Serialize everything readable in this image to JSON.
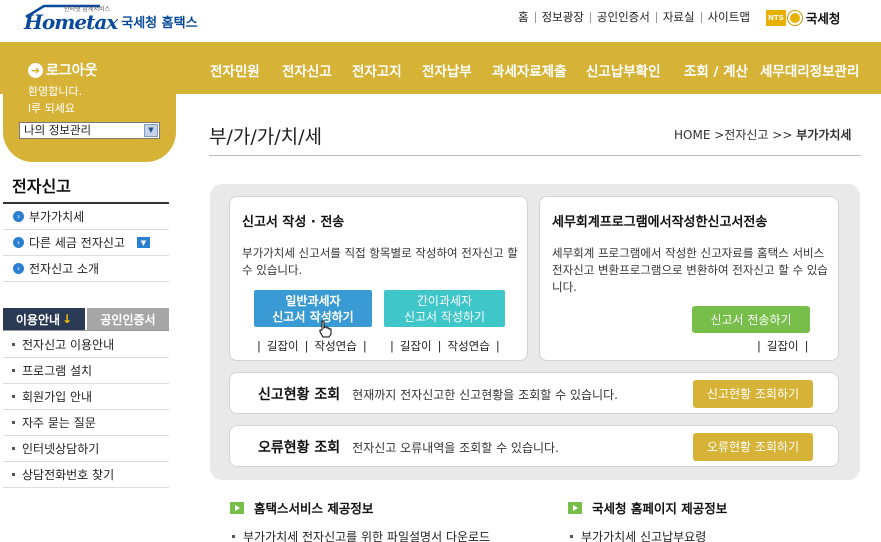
{
  "header": {
    "logo_small": "인터넷 납세서비스",
    "logo_word": "Hometax",
    "logo_sub": "국세청 홈택스",
    "top_links": [
      "홈",
      "정보광장",
      "공인인증서",
      "자료실",
      "사이트맵"
    ],
    "nts_badge": "NTS",
    "nts_name": "국세청"
  },
  "nav": {
    "items": [
      "전자민원",
      "전자신고",
      "전자고지",
      "전자납부",
      "과세자료제출",
      "신고납부확인",
      "조회 / 계산",
      "세무대리정보관리"
    ]
  },
  "login": {
    "logout_label": "로그아웃",
    "welcome_line1": "환영합니다.",
    "welcome_line2": "l루 되세요",
    "my_info_select": "나의 정보관리"
  },
  "sidebar": {
    "title": "전자신고",
    "items": [
      {
        "label": "부가가치세"
      },
      {
        "label": "다른 세금 전자신고"
      },
      {
        "label": "전자신고 소개"
      }
    ],
    "tab_guide": "이용안내",
    "tab_guide_arrow": "↓",
    "tab_cert": "공인인증서",
    "guide_items": [
      "전자신고 이용안내",
      "프로그램 설치",
      "회원가입 안내",
      "자주 묻는 질문",
      "인터넷상담하기",
      "상담전화번호 찾기"
    ]
  },
  "main": {
    "page_title": "부/가/가/치/세",
    "breadcrumb": {
      "home": "HOME",
      "sep1": ">",
      "level1": "전자신고",
      "sep2": ">>",
      "current": "부가가치세"
    },
    "card_write": {
      "title": "신고서 작성 · 전송",
      "desc": "부가가치세 신고서를 직접 항목별로 작성하여 전자신고 할 수 있습니다.",
      "btn_general_line1": "일반과세자",
      "btn_general_line2": "신고서 작성하기",
      "btn_simple_line1": "간이과세자",
      "btn_simple_line2": "신고서 작성하기",
      "guide_link": "길잡이",
      "practice_link": "작성연습"
    },
    "card_program": {
      "title": "세무회계프로그램에서작성한신고서전송",
      "desc": "세무회계 프로그램에서 작성한 신고자료를 홈택스 서비스 전자신고 변환프로그램으로 변환하여 전자신고 할 수 있습니다.",
      "btn_send": "신고서 전송하기",
      "guide_link": "길잡이"
    },
    "status": {
      "title": "신고현황 조회",
      "desc": "현재까지 전자신고한 신고현황을 조회할 수 있습니다.",
      "button": "신고현황 조회하기"
    },
    "errors": {
      "title": "오류현황 조회",
      "desc": "전자신고 오류내역을 조회할 수 있습니다.",
      "button": "오류현황 조회하기"
    },
    "info_hometax": {
      "title": "홈택스서비스 제공정보",
      "items": [
        "부가가치세 전자신고를 위한 파일설명서 다운로드"
      ]
    },
    "info_nts": {
      "title": "국세청 홈페이지 제공정보",
      "items": [
        "부가가치세 신고납부요령"
      ]
    }
  },
  "colors": {
    "gold": "#d6b336",
    "blue_button": "#3a9ad4",
    "teal_button": "#3ec6c8",
    "green_button": "#77bf4a",
    "navy_tab": "#2a3a55"
  }
}
